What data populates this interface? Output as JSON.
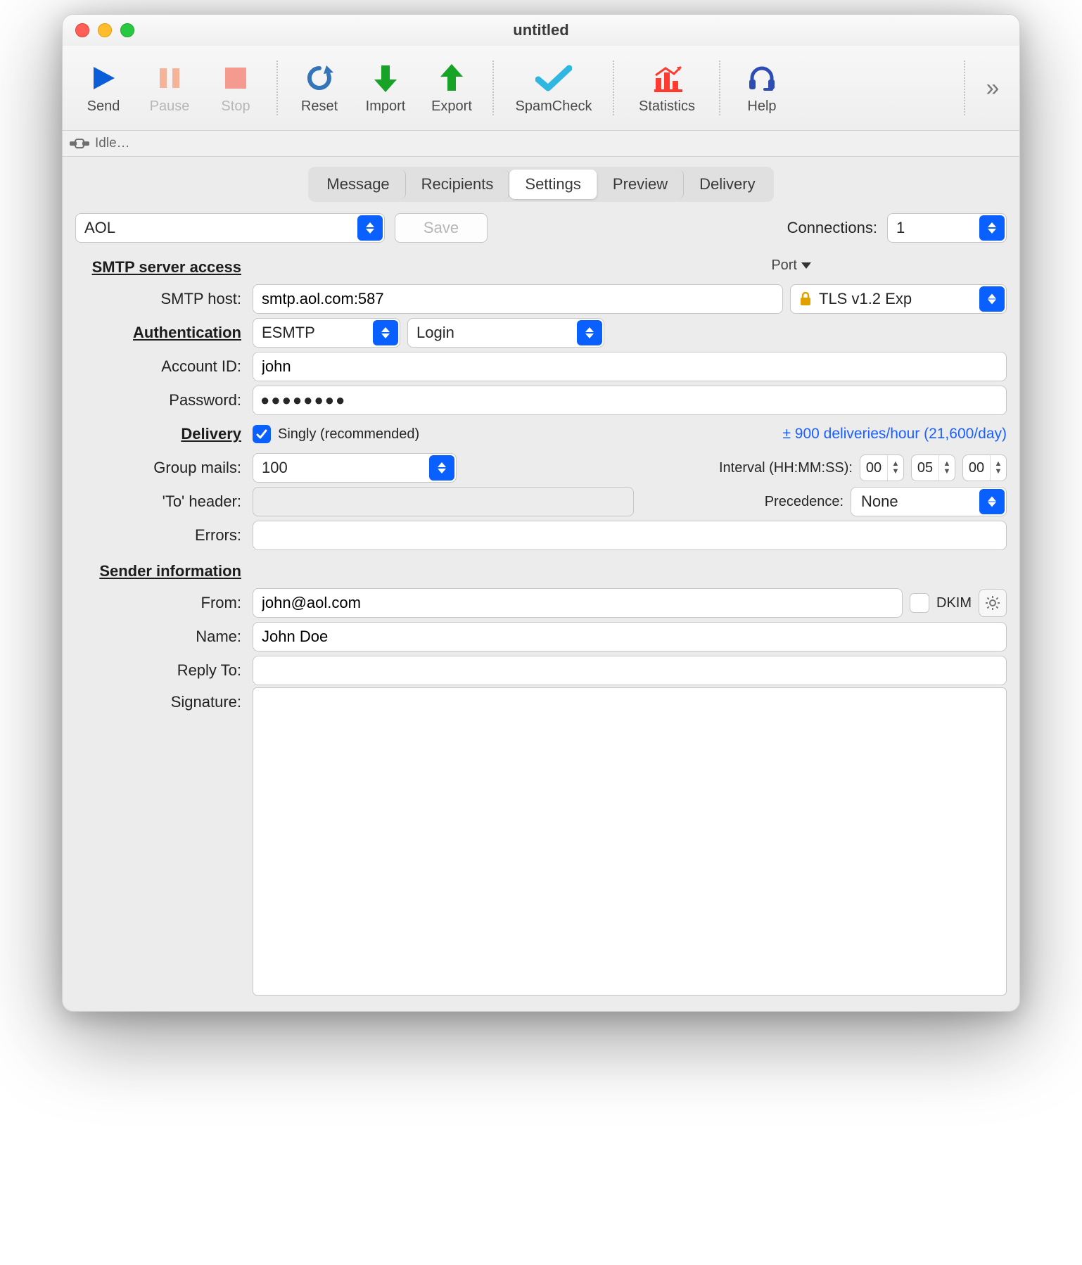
{
  "window": {
    "title": "untitled"
  },
  "toolbar": {
    "send": "Send",
    "pause": "Pause",
    "stop": "Stop",
    "reset": "Reset",
    "import": "Import",
    "export": "Export",
    "spamcheck": "SpamCheck",
    "statistics": "Statistics",
    "help": "Help"
  },
  "status": {
    "text": "Idle…"
  },
  "tabs": {
    "items": [
      "Message",
      "Recipients",
      "Settings",
      "Preview",
      "Delivery"
    ],
    "active": "Settings"
  },
  "top": {
    "preset": "AOL",
    "save": "Save",
    "connections_label": "Connections:",
    "connections_value": "1"
  },
  "sections": {
    "smtp": "SMTP server access",
    "auth": "Authentication",
    "delivery": "Delivery",
    "sender": "Sender information"
  },
  "labels": {
    "smtp_host": "SMTP host:",
    "port": "Port ▼",
    "account_id": "Account ID:",
    "password": "Password:",
    "group_mails": "Group mails:",
    "interval": "Interval (HH:MM:SS):",
    "to_header": "'To' header:",
    "precedence": "Precedence:",
    "errors": "Errors:",
    "from": "From:",
    "name": "Name:",
    "reply_to": "Reply To:",
    "signature": "Signature:",
    "dkim": "DKIM"
  },
  "values": {
    "smtp_host": "smtp.aol.com:587",
    "tls": "TLS v1.2 Exp",
    "auth_mode": "ESMTP",
    "auth_method": "Login",
    "account_id": "john",
    "password_mask": "●●●●●●●●",
    "singly_label": "Singly (recommended)",
    "singly_checked": true,
    "delivery_rate": "± 900 deliveries/hour (21,600/day)",
    "group_mails": "100",
    "interval_hh": "00",
    "interval_mm": "05",
    "interval_ss": "00",
    "to_header": "",
    "precedence": "None",
    "errors": "",
    "from": "john@aol.com",
    "dkim_checked": false,
    "name": "John Doe",
    "reply_to": "",
    "signature": ""
  }
}
